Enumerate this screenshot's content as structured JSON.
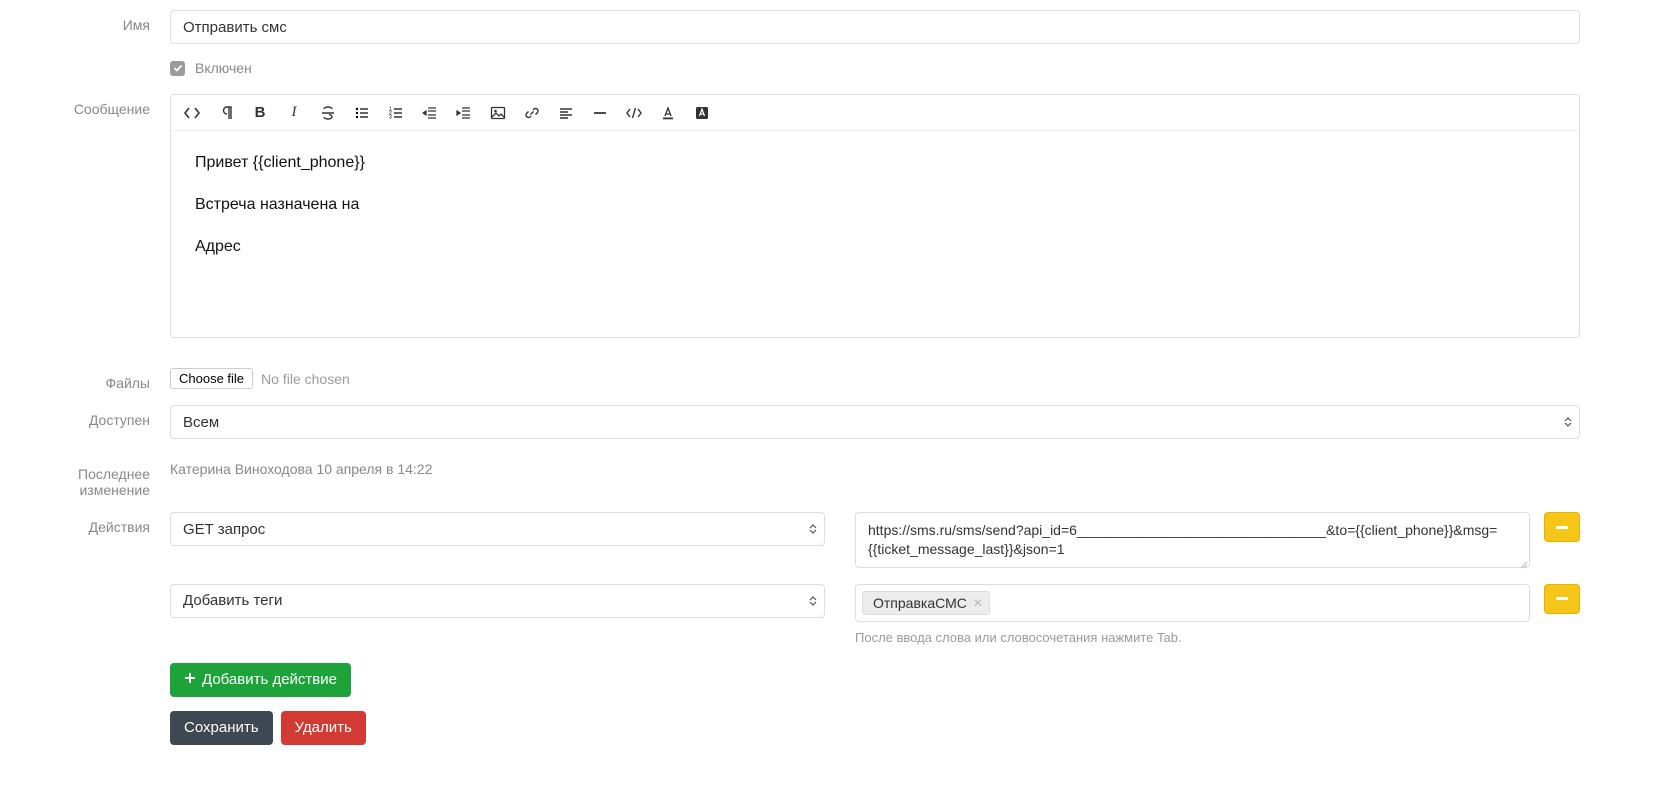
{
  "labels": {
    "name": "Имя",
    "enabled": "Включен",
    "message": "Сообщение",
    "files": "Файлы",
    "available": "Доступен",
    "last_change": "Последнее изменение",
    "actions": "Действия"
  },
  "name_field": {
    "value": "Отправить смс"
  },
  "enabled_checkbox": {
    "checked": true
  },
  "editor": {
    "line1": "Привет {{client_phone}}",
    "line2": "Встреча назначена на",
    "line3": "Адрес"
  },
  "files": {
    "choose_label": "Choose file",
    "status": "No file chosen"
  },
  "available_select": {
    "value": "Всем"
  },
  "last_change_text": "Катерина Виноходова 10 апреля в 14:22",
  "actions_list": {
    "row1": {
      "type": "GET запрос",
      "url": "https://sms.ru/sms/send?api_id=6________________________________&to={{client_phone}}&msg={{ticket_message_last}}&json=1"
    },
    "row2": {
      "type": "Добавить теги",
      "tag": "ОтправкаСМС",
      "hint": "После ввода слова или словосочетания нажмите Tab."
    }
  },
  "buttons": {
    "add_action": "Добавить действие",
    "save": "Сохранить",
    "delete": "Удалить"
  }
}
